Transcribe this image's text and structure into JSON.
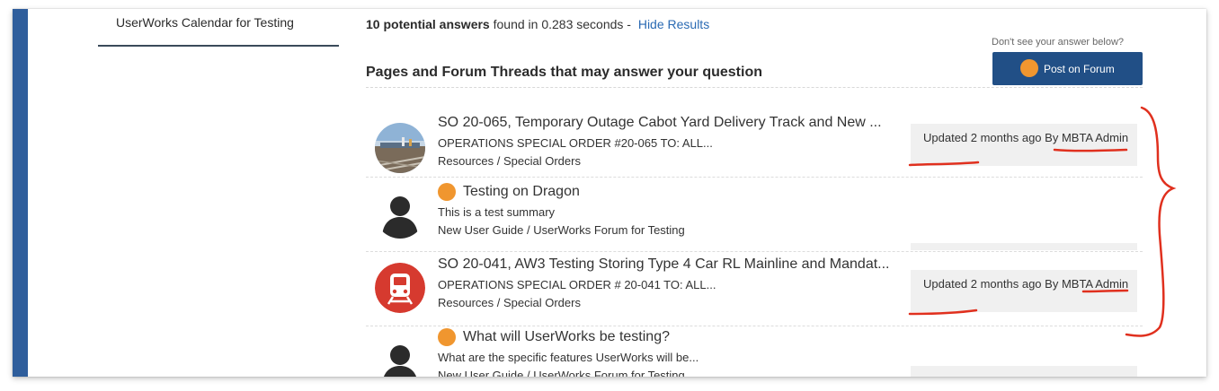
{
  "sidebar": {
    "selected_label": "UserWorks Calendar for Testing"
  },
  "results": {
    "count_label": "10 potential answers",
    "time_label": " found in 0.283 seconds - ",
    "hide_label": "Hide Results",
    "section_title": "Pages and Forum Threads that may answer your question",
    "dont_see": "Don't see your answer below?",
    "post_label": "Post on Forum",
    "items": [
      {
        "title": "SO 20-065, Temporary Outage Cabot Yard Delivery Track and New ...",
        "summary": "OPERATIONS SPECIAL ORDER #20-065 TO: ALL...",
        "path": "Resources / Special Orders",
        "meta_updated": "Updated 2 months ago By ",
        "meta_author": "MBTA Admin"
      },
      {
        "title": "Testing on Dragon",
        "summary": "This is a test summary",
        "path": "New User Guide / UserWorks Forum for Testing"
      },
      {
        "title": "SO 20-041, AW3 Testing Storing Type 4 Car RL Mainline and Mandat...",
        "summary": "OPERATIONS SPECIAL ORDER # 20-041 TO: ALL...",
        "path": "Resources / Special Orders",
        "meta_updated": "Updated 2 months ago By ",
        "meta_author": "MBTA Admin"
      },
      {
        "title": "What will UserWorks be testing?",
        "summary": "What are the specific features UserWorks will be...",
        "path": "New User Guide / UserWorks Forum for Testing"
      }
    ]
  },
  "colors": {
    "accent_blue": "#2f5e9c",
    "button_blue": "#214f86",
    "forum_dot": "#f0962f",
    "link_blue": "#2a6ab3",
    "annotation_red": "#e0301e"
  },
  "icons": {
    "forum_post": "orange-dot-icon",
    "user": "user-silhouette-icon",
    "train": "train-icon"
  }
}
